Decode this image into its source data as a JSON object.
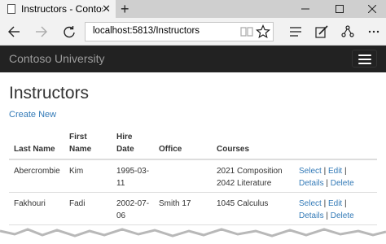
{
  "browser": {
    "tab_title": "Instructors - Contoso Ur",
    "tab_close": "✕",
    "new_tab": "+",
    "url": "localhost:5813/Instructors"
  },
  "navbar": {
    "brand": "Contoso University"
  },
  "page": {
    "title": "Instructors",
    "create_link": "Create New"
  },
  "table": {
    "headers": {
      "last_name": "Last Name",
      "first_name_1": "First",
      "first_name_2": "Name",
      "hire_date_1": "Hire",
      "hire_date_2": "Date",
      "office": "Office",
      "courses": "Courses"
    },
    "rows": [
      {
        "last_name": "Abercrombie",
        "first_name": "Kim",
        "hire_date_1": "1995-03-",
        "hire_date_2": "11",
        "office": "",
        "course_1": "2021 Composition",
        "course_2": "2042 Literature",
        "select": "Select",
        "edit": "Edit",
        "details": "Details",
        "delete": "Delete"
      },
      {
        "last_name": "Fakhouri",
        "first_name": "Fadi",
        "hire_date_1": "2002-07-",
        "hire_date_2": "06",
        "office": "Smith 17",
        "course_1": "1045 Calculus",
        "course_2": "",
        "select": "Select",
        "edit": "Edit",
        "details": "Details",
        "delete": "Delete"
      }
    ],
    "separator": "|"
  }
}
